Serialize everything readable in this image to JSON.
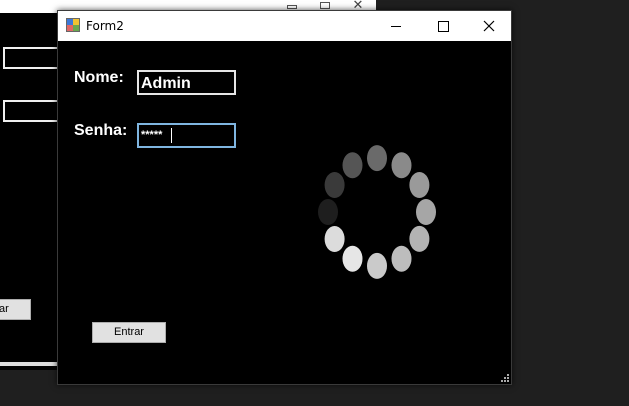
{
  "background_window": {
    "button_label": "ar"
  },
  "form": {
    "title": "Form2",
    "nome_label": "Nome:",
    "nome_value": "Admin",
    "senha_label": "Senha:",
    "senha_value": "*****",
    "entrar_label": "Entrar"
  },
  "spinner": {
    "dot_count": 12,
    "dot_colors": [
      "#6a6a6a",
      "#8a8a8a",
      "#9a9a9a",
      "#a6a6a6",
      "#b3b3b3",
      "#bdbdbd",
      "#cacaca",
      "#e6e6e6",
      "#dcdcdc",
      "#1e1e1e",
      "#3a3a3a",
      "#555555"
    ]
  },
  "colors": {
    "form_background": "#000000",
    "password_focus_border": "#7fb5e0"
  }
}
